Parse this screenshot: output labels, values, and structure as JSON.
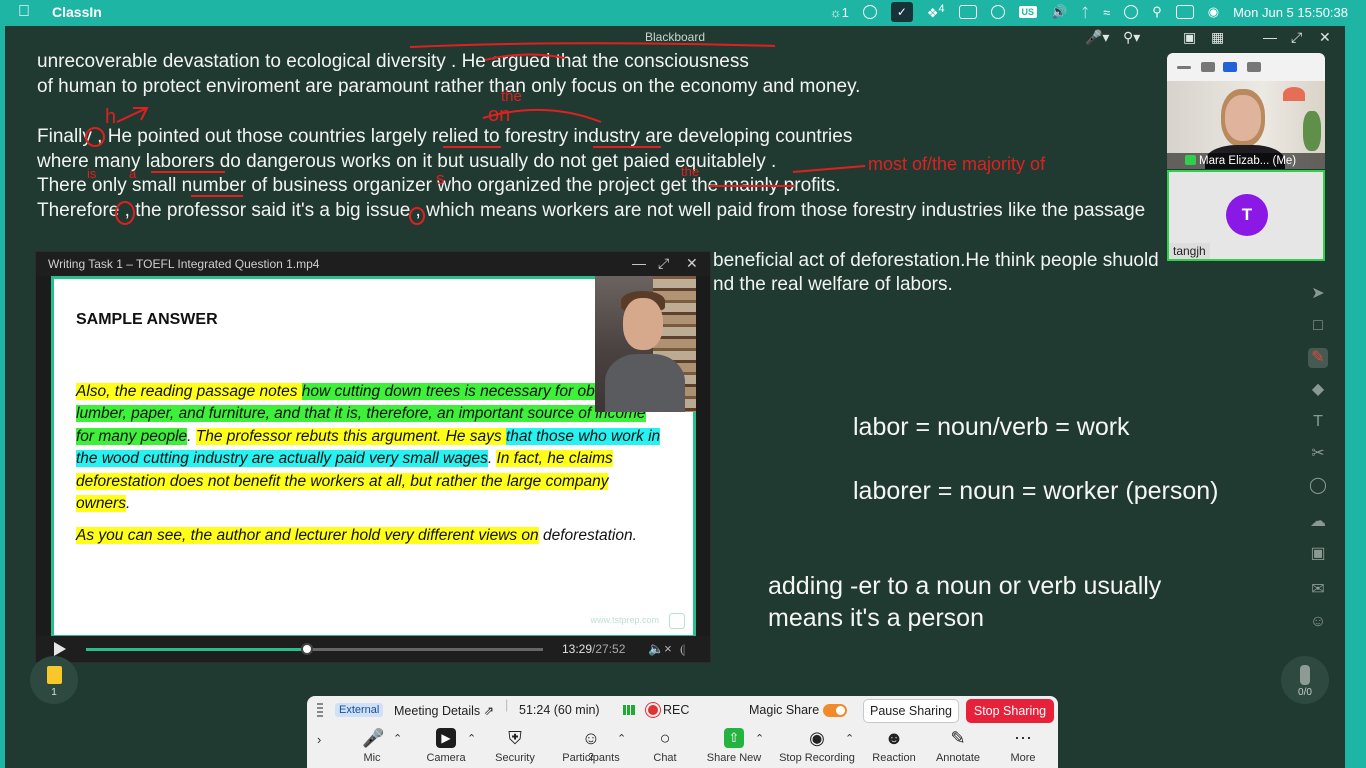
{
  "menubar": {
    "app_name": "ClassIn",
    "notification_count": "1",
    "dropbox_badge": "4",
    "input_source": "US",
    "datetime": "Mon Jun 5  15:50:38"
  },
  "board": {
    "title": "Blackboard",
    "lines": [
      "unrecoverable devastation to ecological diversity . He argued that the consciousness",
      "of human to protect enviroment are paramount rather than only focus on the economy and money.",
      "Finally , He pointed out those countries largely relied to forestry industry are developing countries",
      " where many laborers do dangerous works on it but usually do not get paied equitablely .",
      "There only small number of business organizer who organized the project get the mainly profits.",
      "Therefore , the professor said it's a big issue , which means workers are not well paid from those forestry industries like the passage",
      "beneficial act of deforestation.He think people shuold",
      "nd the real welfare of labors."
    ],
    "red_annotations": {
      "h": "h",
      "the_on": "the",
      "on": "on",
      "is": "is",
      "a": "a",
      "s": "s",
      "the2": "the",
      "majority": "most of/the majority of"
    },
    "notes": {
      "labor": "labor = noun/verb = work",
      "laborer": "laborer = noun = worker (person)",
      "er_line1": "adding -er to a noun or verb usually",
      "er_line2": "means it's a person"
    }
  },
  "video": {
    "title": "Writing Task 1 – TOEFL Integrated Question 1.mp4",
    "heading": "SAMPLE ANSWER",
    "p1_s1": "Also, the reading passage notes ",
    "p1_s2": "how cutting down trees is necessary for obtaining lumber, paper, and furniture, and that it is, therefore, an important source of income for many people",
    "p1_s3": ". ",
    "p1_s4": "The professor rebuts this argument. He says ",
    "p1_s5": "that those who work in the wood cutting industry are actually paid very small wages",
    "p1_s6": ". ",
    "p1_s7": "In fact, he claims deforestation does not benefit the workers at all, but rather the large company owners",
    "p1_s8": ".",
    "p2_s1": "As you can see, the author and lecturer hold very different views on",
    "p2_s2": " deforestation.",
    "watermark": "www.tstprep.com",
    "current_time": "13:29",
    "total_time": "/27:52",
    "progress": 0.484
  },
  "gallery": {
    "me_label": "Mara Elizab... (Me)",
    "t_initial": "T",
    "t_name": "tangjh"
  },
  "badges": {
    "docs_count": "1",
    "people_count": "0/0"
  },
  "zoom": {
    "external": "External",
    "meeting_details": "Meeting Details",
    "timer": "51:24  (60 min)",
    "rec": "REC",
    "magic_share": "Magic Share",
    "pause_sharing": "Pause Sharing",
    "stop_sharing": "Stop Sharing",
    "participants_count": "2",
    "buttons": {
      "mic": "Mic",
      "camera": "Camera",
      "security": "Security",
      "participants": "Participants",
      "chat": "Chat",
      "share_new": "Share New",
      "stop_recording": "Stop Recording",
      "reaction": "Reaction",
      "annotate": "Annotate",
      "more": "More"
    }
  }
}
